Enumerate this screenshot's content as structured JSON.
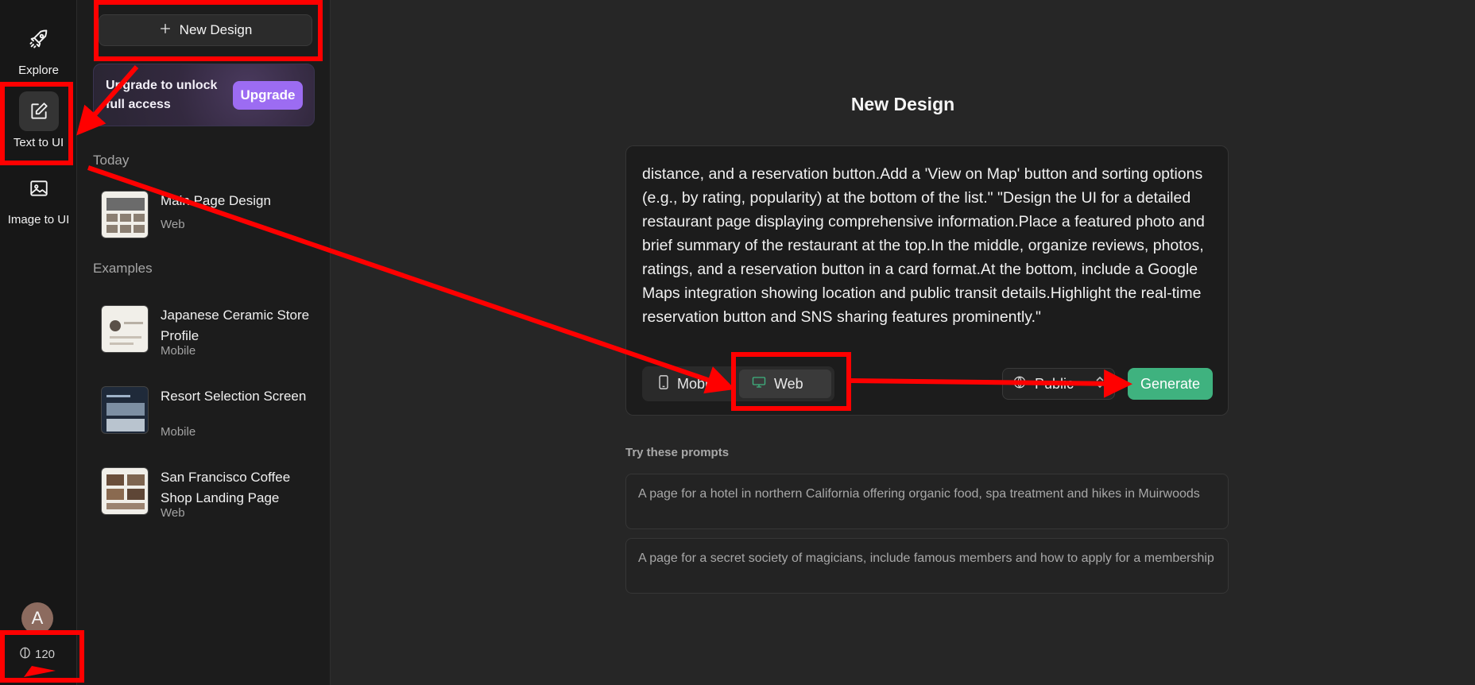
{
  "rail": {
    "items": [
      {
        "label": "Explore",
        "icon": "rocket-icon"
      },
      {
        "label": "Text to UI",
        "icon": "edit-icon",
        "active": true
      },
      {
        "label": "Image to UI",
        "icon": "image-icon"
      }
    ],
    "avatar_initial": "A",
    "credits": "120"
  },
  "sidebar": {
    "new_button": "New Design",
    "upgrade_text": "Upgrade to unlock full access",
    "upgrade_button": "Upgrade",
    "today_heading": "Today",
    "today_items": [
      {
        "title": "Main Page Design",
        "platform": "Web"
      }
    ],
    "examples_heading": "Examples",
    "example_items": [
      {
        "title": "Japanese Ceramic Store Profile",
        "platform": "Mobile"
      },
      {
        "title": "Resort Selection Screen",
        "platform": "Mobile"
      },
      {
        "title": "San Francisco Coffee Shop Landing Page",
        "platform": "Web"
      }
    ]
  },
  "main": {
    "title": "New Design",
    "prompt_text": "distance, and a reservation button.Add a 'View on Map' button and sorting options (e.g., by rating, popularity) at the bottom of the list.\" \"Design the UI for a detailed restaurant page displaying comprehensive information.Place a featured photo and brief summary of the restaurant at the top.In the middle, organize reviews, photos, ratings, and a reservation button in a card format.At the bottom, include a Google Maps integration showing location and public transit details.Highlight the real-time reservation button and SNS sharing features prominently.\"",
    "platform_options": [
      {
        "label": "Mobile",
        "active": false
      },
      {
        "label": "Web",
        "active": true
      }
    ],
    "visibility": "Public",
    "generate_button": "Generate",
    "try_heading": "Try these prompts",
    "suggestions": [
      "A page for a hotel in northern California offering organic food, spa treatment and hikes in Muirwoods",
      "A page for a secret society of magicians, include famous members and how to apply for a membership"
    ]
  },
  "colors": {
    "accent_green": "#3fb27f",
    "upgrade_purple": "#9c6cf2",
    "annotation_red": "#ff0000"
  }
}
